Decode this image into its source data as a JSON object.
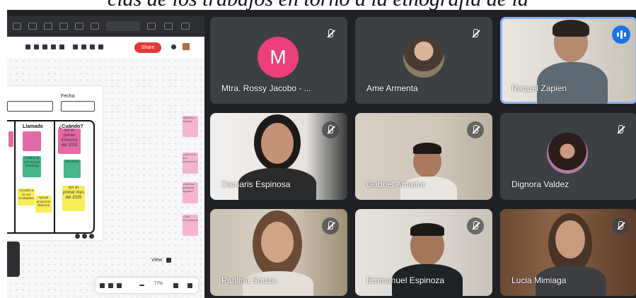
{
  "caption": "cias de los trabajos en torno a la etnografía de la",
  "presentation": {
    "share_button": "Share",
    "zoom_level": "77%",
    "date_label": "Fecha",
    "col_llamado": "Llamado",
    "col_cuando": "¿Cuándo?",
    "stickies": {
      "s1": "En el primer trimestre del 2025",
      "s2": "Unete a la red Vecinal #Hashtag",
      "s3": "Recursos",
      "s4": "En el primer mes del 2025",
      "s5": "Acceder a la red Ciudadana",
      "s6": "Apoyar proyectos diversos"
    },
    "side_notes": [
      "Objetivo y Alcance",
      "¿Qué es lo que buscamos?",
      "¿Qué tan podemos lograrlo?",
      "¿Qué necesitamos?"
    ],
    "view_label": "View"
  },
  "participants": [
    {
      "name": "Mtra. Rossy Jacobo - ...",
      "avatar_letter": "M",
      "muted": true,
      "video": false
    },
    {
      "name": "Ame Armenta",
      "muted": true,
      "video": false
    },
    {
      "name": "Raquel Zapien",
      "muted": false,
      "speaking": true,
      "video": true
    },
    {
      "name": "Damaris Espinosa",
      "muted": true,
      "video": true
    },
    {
      "name": "Gabriel Amador",
      "muted": true,
      "video": true
    },
    {
      "name": "Dignora Valdez",
      "muted": true,
      "video": false
    },
    {
      "name": "Paulina Souza",
      "muted": true,
      "video": true
    },
    {
      "name": "Emmanuel Espinoza",
      "muted": true,
      "video": true
    },
    {
      "name": "Lucia Mimiaga",
      "muted": true,
      "video": true
    }
  ],
  "colors": {
    "meet_bg": "#202124",
    "tile_bg": "#3c4043",
    "active_border": "#8ab4f8",
    "avatar_m": "#ec407a",
    "share_red": "#e53935"
  }
}
